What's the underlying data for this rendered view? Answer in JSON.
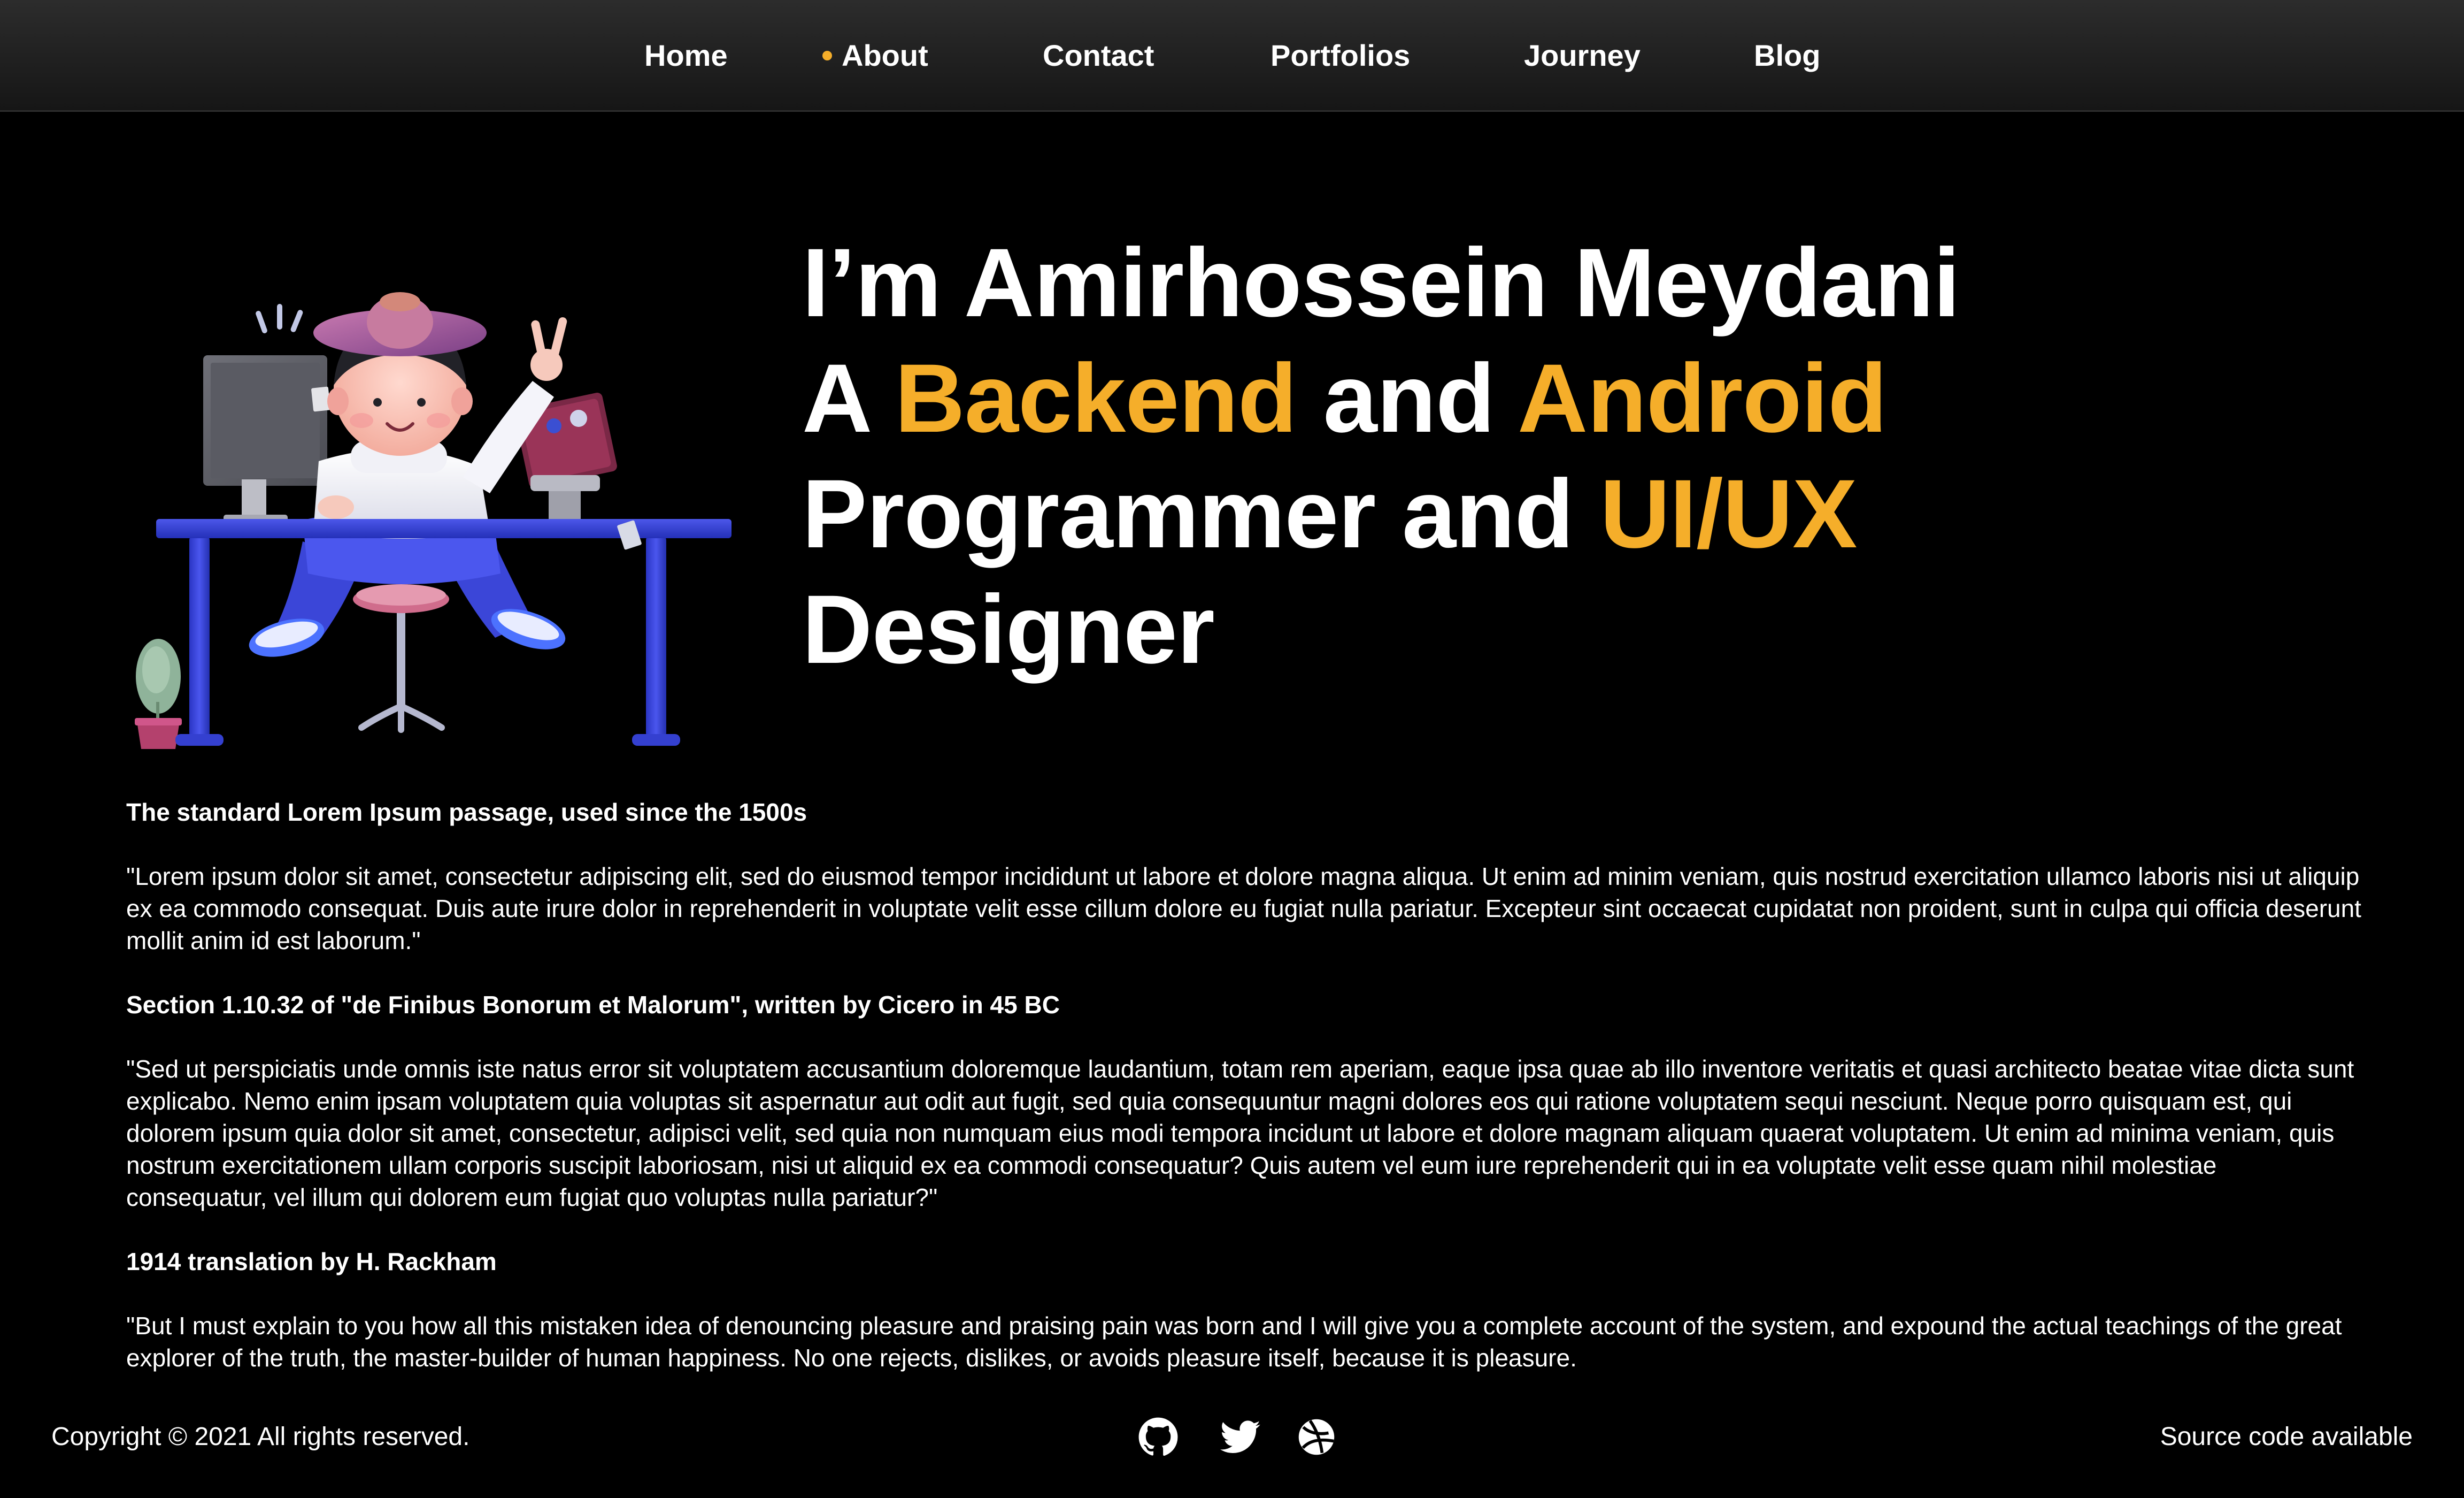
{
  "colors": {
    "accent": "#f5ae2a",
    "background": "#000000",
    "nav_background": "#1f1f1f",
    "text": "#ffffff"
  },
  "nav": {
    "items": [
      {
        "label": "Home",
        "active": false
      },
      {
        "label": "About",
        "active": true
      },
      {
        "label": "Contact",
        "active": false
      },
      {
        "label": "Portfolios",
        "active": false
      },
      {
        "label": "Journey",
        "active": false
      },
      {
        "label": "Blog",
        "active": false
      }
    ],
    "active_indicator_icon": "dot-icon"
  },
  "hero": {
    "illustration_icon": "developer-at-desk-illustration",
    "line1": "I’m Amirhossein Meydani",
    "line2_prefix": "A ",
    "line2_accent1": "Backend",
    "line2_mid": " and ",
    "line2_accent2": "Android",
    "line3_prefix": "Programmer and ",
    "line3_accent": "UI/UX",
    "line4": "Designer"
  },
  "content": {
    "heading1": "The standard Lorem Ipsum passage, used since the 1500s",
    "paragraph1": "\"Lorem ipsum dolor sit amet, consectetur adipiscing elit, sed do eiusmod tempor incididunt ut labore et dolore magna aliqua. Ut enim ad minim veniam, quis nostrud exercitation ullamco laboris nisi ut aliquip ex ea commodo consequat. Duis aute irure dolor in reprehenderit in voluptate velit esse cillum dolore eu fugiat nulla pariatur. Excepteur sint occaecat cupidatat non proident, sunt in culpa qui officia deserunt mollit anim id est laborum.\"",
    "heading2": "Section 1.10.32 of \"de Finibus Bonorum et Malorum\", written by Cicero in 45 BC",
    "paragraph2": "\"Sed ut perspiciatis unde omnis iste natus error sit voluptatem accusantium doloremque laudantium, totam rem aperiam, eaque ipsa quae ab illo inventore veritatis et quasi architecto beatae vitae dicta sunt explicabo. Nemo enim ipsam voluptatem quia voluptas sit aspernatur aut odit aut fugit, sed quia consequuntur magni dolores eos qui ratione voluptatem sequi nesciunt. Neque porro quisquam est, qui dolorem ipsum quia dolor sit amet, consectetur, adipisci velit, sed quia non numquam eius modi tempora incidunt ut labore et dolore magnam aliquam quaerat voluptatem. Ut enim ad minima veniam, quis nostrum exercitationem ullam corporis suscipit laboriosam, nisi ut aliquid ex ea commodi consequatur? Quis autem vel eum iure reprehenderit qui in ea voluptate velit esse quam nihil molestiae consequatur, vel illum qui dolorem eum fugiat quo voluptas nulla pariatur?\"",
    "heading3": "1914 translation by H. Rackham",
    "paragraph3": "\"But I must explain to you how all this mistaken idea of denouncing pleasure and praising pain was born and I will give you a complete account of the system, and expound the actual teachings of the great explorer of the truth, the master-builder of human happiness. No one rejects, dislikes, or avoids pleasure itself, because it is pleasure."
  },
  "footer": {
    "copyright": "Copyright © 2021 All rights reserved.",
    "source_code": "Source code available",
    "social_icons": [
      "github-icon",
      "twitter-icon",
      "dribbble-icon"
    ]
  }
}
